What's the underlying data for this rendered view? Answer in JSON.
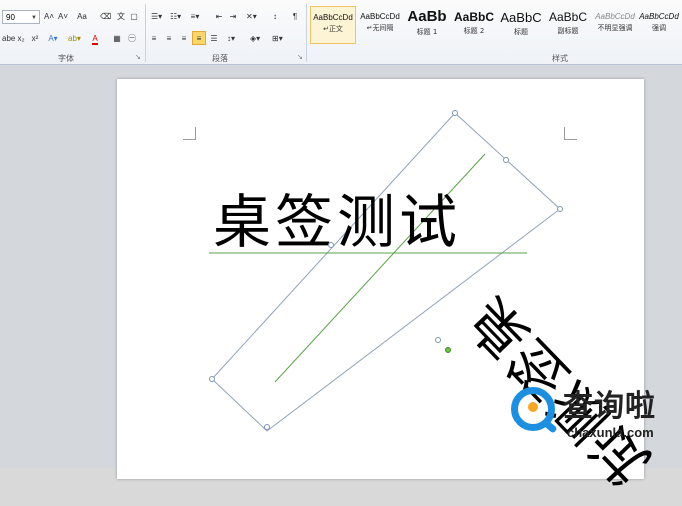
{
  "ribbon": {
    "font_group": {
      "label": "字体",
      "font_size": "90",
      "row1_icons": [
        "grow-font-icon",
        "shrink-font-icon",
        "change-case-icon",
        "clear-format-icon",
        "phonetic-guide-icon",
        "char-border-icon"
      ],
      "row2_labels": [
        "abe",
        "x₂",
        "x²"
      ],
      "grow_label": "A˄",
      "shrink_label": "A˅",
      "case_label": "Aa",
      "font_color_label": "A"
    },
    "paragraph_group": {
      "label": "段落"
    },
    "styles_group": {
      "label": "样式",
      "items": [
        {
          "preview": "AaBbCcDd",
          "name": "正文",
          "selected": true
        },
        {
          "preview": "AaBbCcDd",
          "name": "无间隔",
          "selected": false
        },
        {
          "preview": "AaBb",
          "name": "标题 1",
          "selected": false
        },
        {
          "preview": "AaBbC",
          "name": "标题 2",
          "selected": false
        },
        {
          "preview": "AaBbC",
          "name": "标题",
          "selected": false
        },
        {
          "preview": "AaBbC",
          "name": "副标题",
          "selected": false
        },
        {
          "preview": "AaBbCcDd",
          "name": "不明显强调",
          "selected": false
        },
        {
          "preview": "AaBbCcDd",
          "name": "强调",
          "selected": false
        }
      ]
    }
  },
  "document": {
    "main_text": "桌签测试",
    "rotated_text": "桌签测试"
  },
  "watermark": {
    "title": "查询啦",
    "url": "chaxunla.com"
  },
  "colors": {
    "accent": "#f8d66a",
    "watermark_blue": "#1e8fdf",
    "watermark_orange": "#f5a623"
  }
}
